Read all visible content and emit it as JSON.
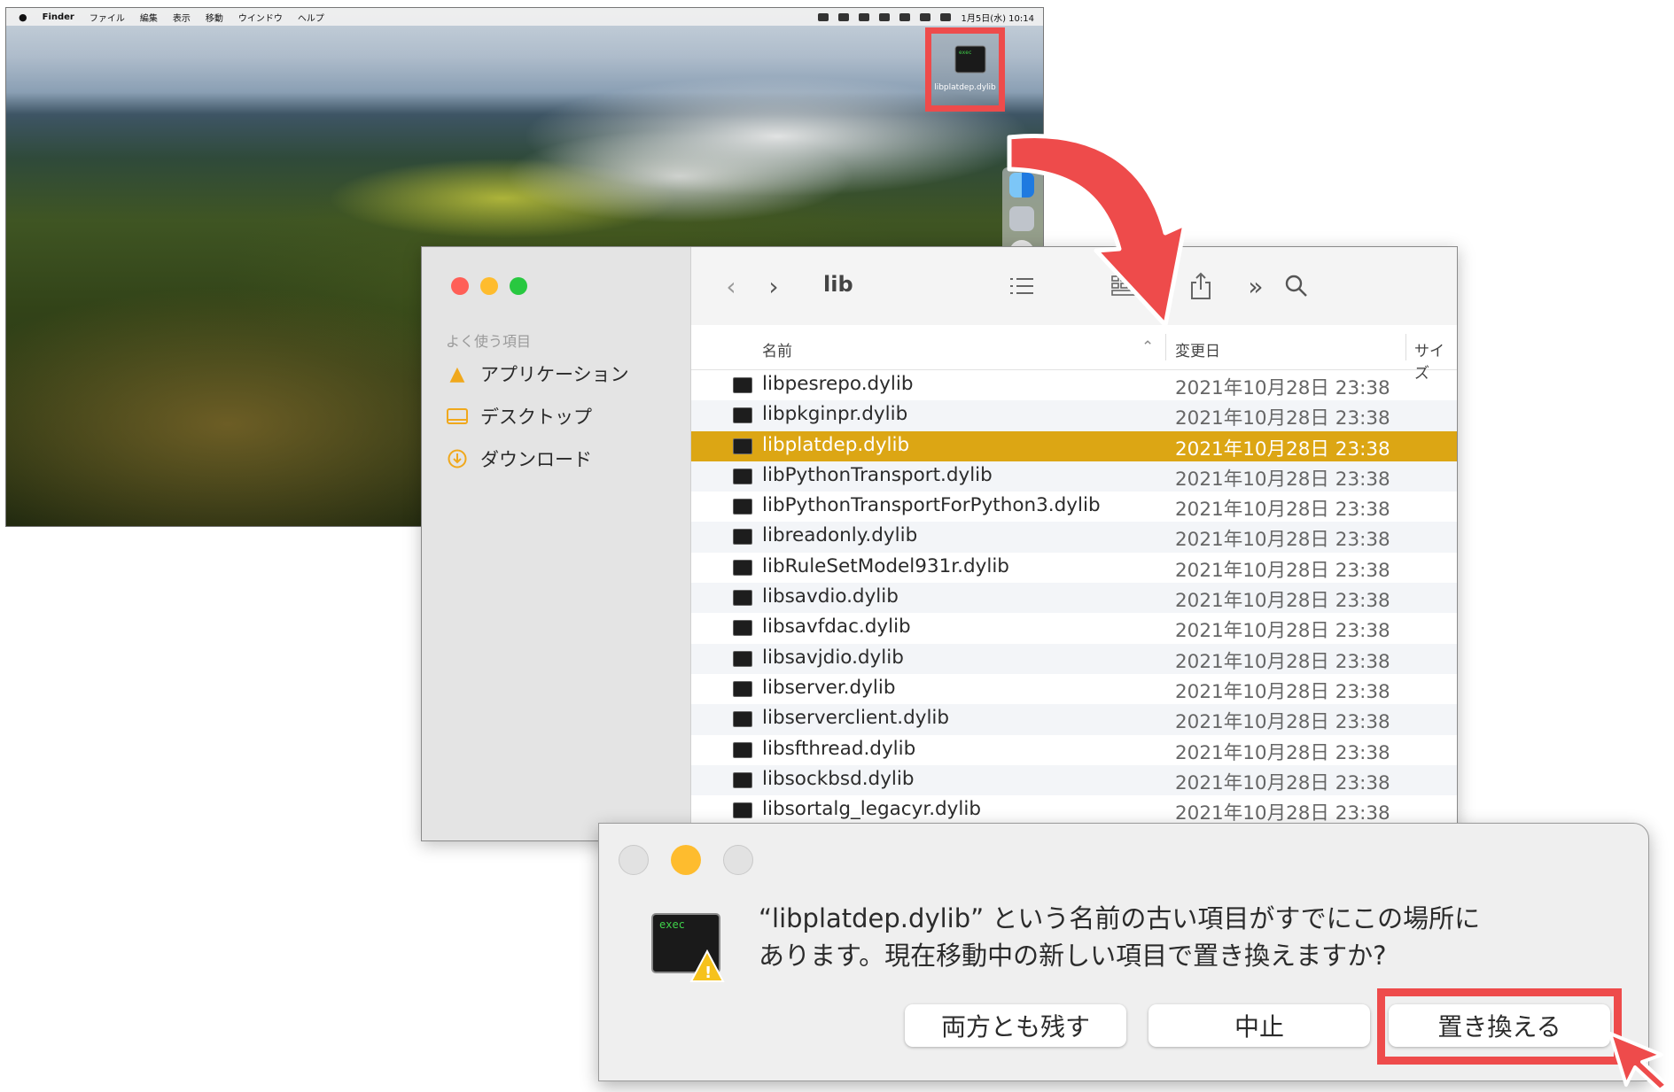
{
  "menubar": {
    "app_name": "Finder",
    "items": [
      "ファイル",
      "編集",
      "表示",
      "移動",
      "ウインドウ",
      "ヘルプ"
    ],
    "clock": "1月5日(水) 10:14"
  },
  "desktop_file": {
    "icon_label": "exec",
    "name": "libplatdep.dylib"
  },
  "finder": {
    "title": "lib",
    "sidebar": {
      "section": "よく使う項目",
      "items": [
        {
          "label": "アプリケーション",
          "icon": "applications-icon"
        },
        {
          "label": "デスクトップ",
          "icon": "desktop-icon"
        },
        {
          "label": "ダウンロード",
          "icon": "downloads-icon"
        }
      ]
    },
    "columns": {
      "name": "名前",
      "modified": "変更日",
      "size": "サイズ"
    },
    "files": [
      {
        "name": "libpesrepo.dylib",
        "date": "2021年10月28日 23:38"
      },
      {
        "name": "libpkginpr.dylib",
        "date": "2021年10月28日 23:38"
      },
      {
        "name": "libplatdep.dylib",
        "date": "2021年10月28日 23:38"
      },
      {
        "name": "libPythonTransport.dylib",
        "date": "2021年10月28日 23:38"
      },
      {
        "name": "libPythonTransportForPython3.dylib",
        "date": "2021年10月28日 23:38"
      },
      {
        "name": "libreadonly.dylib",
        "date": "2021年10月28日 23:38"
      },
      {
        "name": "libRuleSetModel931r.dylib",
        "date": "2021年10月28日 23:38"
      },
      {
        "name": "libsavdio.dylib",
        "date": "2021年10月28日 23:38"
      },
      {
        "name": "libsavfdac.dylib",
        "date": "2021年10月28日 23:38"
      },
      {
        "name": "libsavjdio.dylib",
        "date": "2021年10月28日 23:38"
      },
      {
        "name": "libserver.dylib",
        "date": "2021年10月28日 23:38"
      },
      {
        "name": "libserverclient.dylib",
        "date": "2021年10月28日 23:38"
      },
      {
        "name": "libsfthread.dylib",
        "date": "2021年10月28日 23:38"
      },
      {
        "name": "libsockbsd.dylib",
        "date": "2021年10月28日 23:38"
      },
      {
        "name": "libsortalg_legacyr.dylib",
        "date": "2021年10月28日 23:38"
      }
    ],
    "selected_file": "libplatdep.dylib"
  },
  "dialog": {
    "icon_label": "exec",
    "message_line1": "“libplatdep.dylib” という名前の古い項目がすでにこの場所に",
    "message_line2": "あります。現在移動中の新しい項目で置き換えますか?",
    "buttons": {
      "keep_both": "両方とも残す",
      "stop": "中止",
      "replace": "置き換える"
    }
  },
  "colors": {
    "highlight_red": "#ee4b4b",
    "selection": "#dca614",
    "traffic_red": "#ff5f57",
    "traffic_yellow": "#febc2e",
    "traffic_green": "#28c840"
  }
}
